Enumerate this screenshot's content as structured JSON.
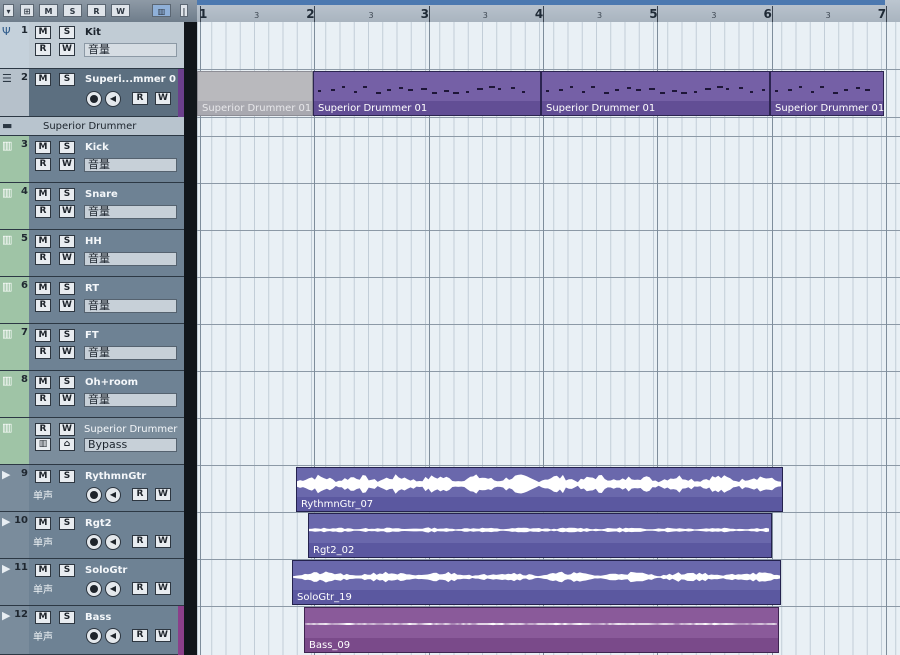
{
  "header": {
    "buttons": [
      "M",
      "S",
      "R",
      "W"
    ],
    "ruler_bars": [
      "1",
      "2",
      "3",
      "4",
      "5",
      "6",
      "7"
    ],
    "ruler_sub": [
      "3",
      "3",
      "3",
      "3",
      "3",
      "3"
    ]
  },
  "tracks": [
    {
      "num": "1",
      "name": "Kit",
      "field": "音量"
    },
    {
      "num": "2",
      "name": "Superi...mmer 0",
      "field": ""
    },
    {
      "folder": "Superior Drummer"
    },
    {
      "num": "3",
      "name": "Kick",
      "field": "音量"
    },
    {
      "num": "4",
      "name": "Snare",
      "field": "音量"
    },
    {
      "num": "5",
      "name": "HH",
      "field": "音量"
    },
    {
      "num": "6",
      "name": "RT",
      "field": "音量"
    },
    {
      "num": "7",
      "name": "FT",
      "field": "音量"
    },
    {
      "num": "8",
      "name": "Oh+room",
      "field": "音量"
    },
    {
      "rack_name": "Superior Drummer",
      "field": "Bypass"
    },
    {
      "num": "9",
      "name": "RythmnGtr",
      "mode": "单声"
    },
    {
      "num": "10",
      "name": "Rgt2",
      "mode": "单声"
    },
    {
      "num": "11",
      "name": "SoloGtr",
      "mode": "单声"
    },
    {
      "num": "12",
      "name": "Bass",
      "mode": "单声"
    }
  ],
  "parts": {
    "midi": [
      "Superior Drummer 01",
      "Superior Drummer 01",
      "Superior Drummer 01",
      "Superior Drummer 01"
    ],
    "audio": [
      "RythmnGtr_07",
      "Rgt2_02",
      "SoloGtr_19",
      "Bass_09"
    ]
  },
  "colors": {
    "midi_part": "#6e5aa0",
    "audio_part": "#6a68a8",
    "bass_part": "#8a5a9a",
    "selection": "#4c79b0"
  }
}
